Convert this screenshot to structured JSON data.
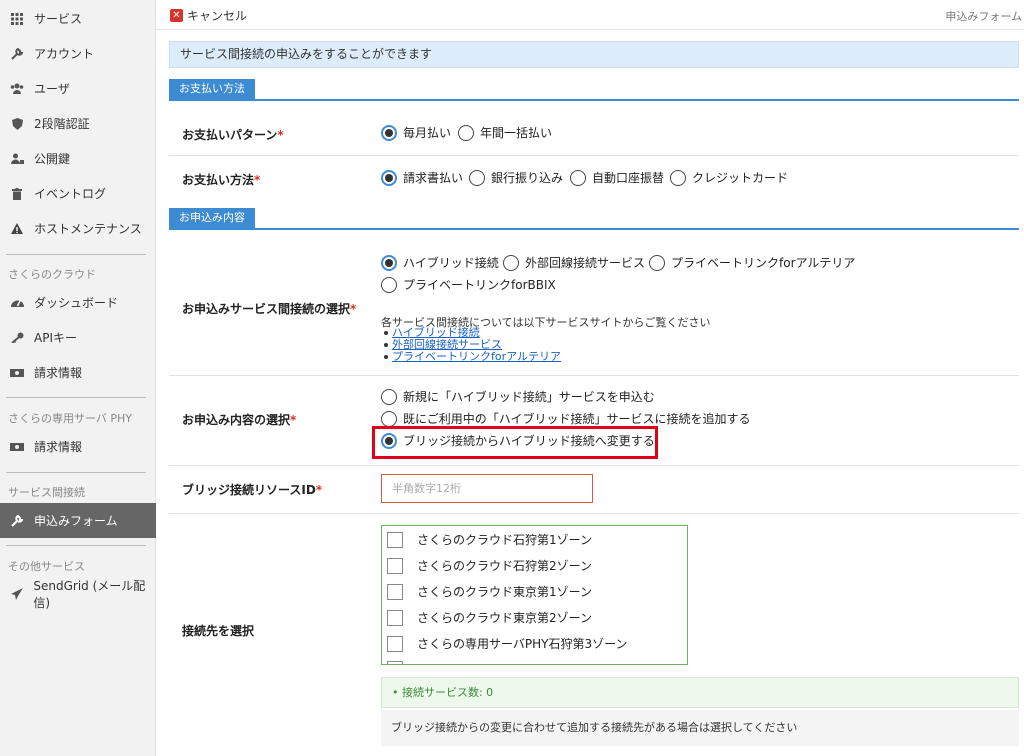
{
  "sidebar": {
    "items": [
      {
        "label": "サービス",
        "icon": "grid-icon"
      },
      {
        "label": "アカウント",
        "icon": "wrench-icon"
      },
      {
        "label": "ユーザ",
        "icon": "users-icon"
      },
      {
        "label": "2段階認証",
        "icon": "shield-icon"
      },
      {
        "label": "公開鍵",
        "icon": "user-key-icon"
      },
      {
        "label": "イベントログ",
        "icon": "trash-icon"
      },
      {
        "label": "ホストメンテナンス",
        "icon": "warning-icon"
      }
    ],
    "cloud_heading": "さくらのクラウド",
    "cloud_items": [
      {
        "label": "ダッシュボード",
        "icon": "dashboard-icon"
      },
      {
        "label": "APIキー",
        "icon": "key-icon"
      },
      {
        "label": "請求情報",
        "icon": "bill-icon"
      }
    ],
    "phy_heading": "さくらの専用サーバ PHY",
    "phy_items": [
      {
        "label": "請求情報",
        "icon": "bill-icon"
      }
    ],
    "interconnect_heading": "サービス間接続",
    "interconnect_items": [
      {
        "label": "申込みフォーム",
        "icon": "wrench-icon",
        "active": true
      }
    ],
    "other_heading": "その他サービス",
    "other_items": [
      {
        "label": "SendGrid (メール配信)",
        "icon": "send-icon"
      }
    ]
  },
  "topbar": {
    "cancel_label": "キャンセル",
    "breadcrumb": "申込みフォーム"
  },
  "notice": "サービス間接続の申込みをすることができます",
  "sections": {
    "payment": "お支払い方法",
    "order": "お申込み内容"
  },
  "payment_pattern": {
    "label": "お支払いパターン",
    "required": "*",
    "options": [
      "毎月払い",
      "年間一括払い"
    ],
    "selected": "毎月払い"
  },
  "payment_method": {
    "label": "お支払い方法",
    "required": "*",
    "options": [
      "請求書払い",
      "銀行振り込み",
      "自動口座振替",
      "クレジットカード"
    ],
    "selected": "請求書払い"
  },
  "service_select": {
    "label": "お申込みサービス間接続の選択",
    "required": "*",
    "options": [
      "ハイブリッド接続",
      "外部回線接続サービス",
      "プライベートリンクforアルテリア",
      "プライベートリンクforBBIX"
    ],
    "selected": "ハイブリッド接続",
    "note": "各サービス間接続については以下サービスサイトからご覧ください",
    "links": [
      "ハイブリッド接続",
      "外部回線接続サービス",
      "プライベートリンクforアルテリア"
    ]
  },
  "order_type": {
    "label": "お申込み内容の選択",
    "required": "*",
    "options": [
      "新規に「ハイブリッド接続」サービスを申込む",
      "既にご利用中の「ハイブリッド接続」サービスに接続を追加する",
      "ブリッジ接続からハイブリッド接続へ変更する"
    ],
    "selected": "ブリッジ接続からハイブリッド接続へ変更する"
  },
  "bridge_id": {
    "label": "ブリッジ接続リソースID",
    "required": "*",
    "placeholder": "半角数字12桁",
    "value": ""
  },
  "destinations": {
    "label": "接続先を選択",
    "options": [
      "さくらのクラウド石狩第1ゾーン",
      "さくらのクラウド石狩第2ゾーン",
      "さくらのクラウド東京第1ゾーン",
      "さくらのクラウド東京第2ゾーン",
      "さくらの専用サーバPHY石狩第3ゾーン"
    ],
    "count_text": "• 接続サービス数: 0",
    "help": "ブリッジ接続からの変更に合わせて追加する接続先がある場合は選択してください"
  },
  "colors": {
    "accent": "#3d8bd3",
    "required": "#d9312b",
    "highlight": "#e0001b",
    "sidebar_active": "#666666"
  }
}
